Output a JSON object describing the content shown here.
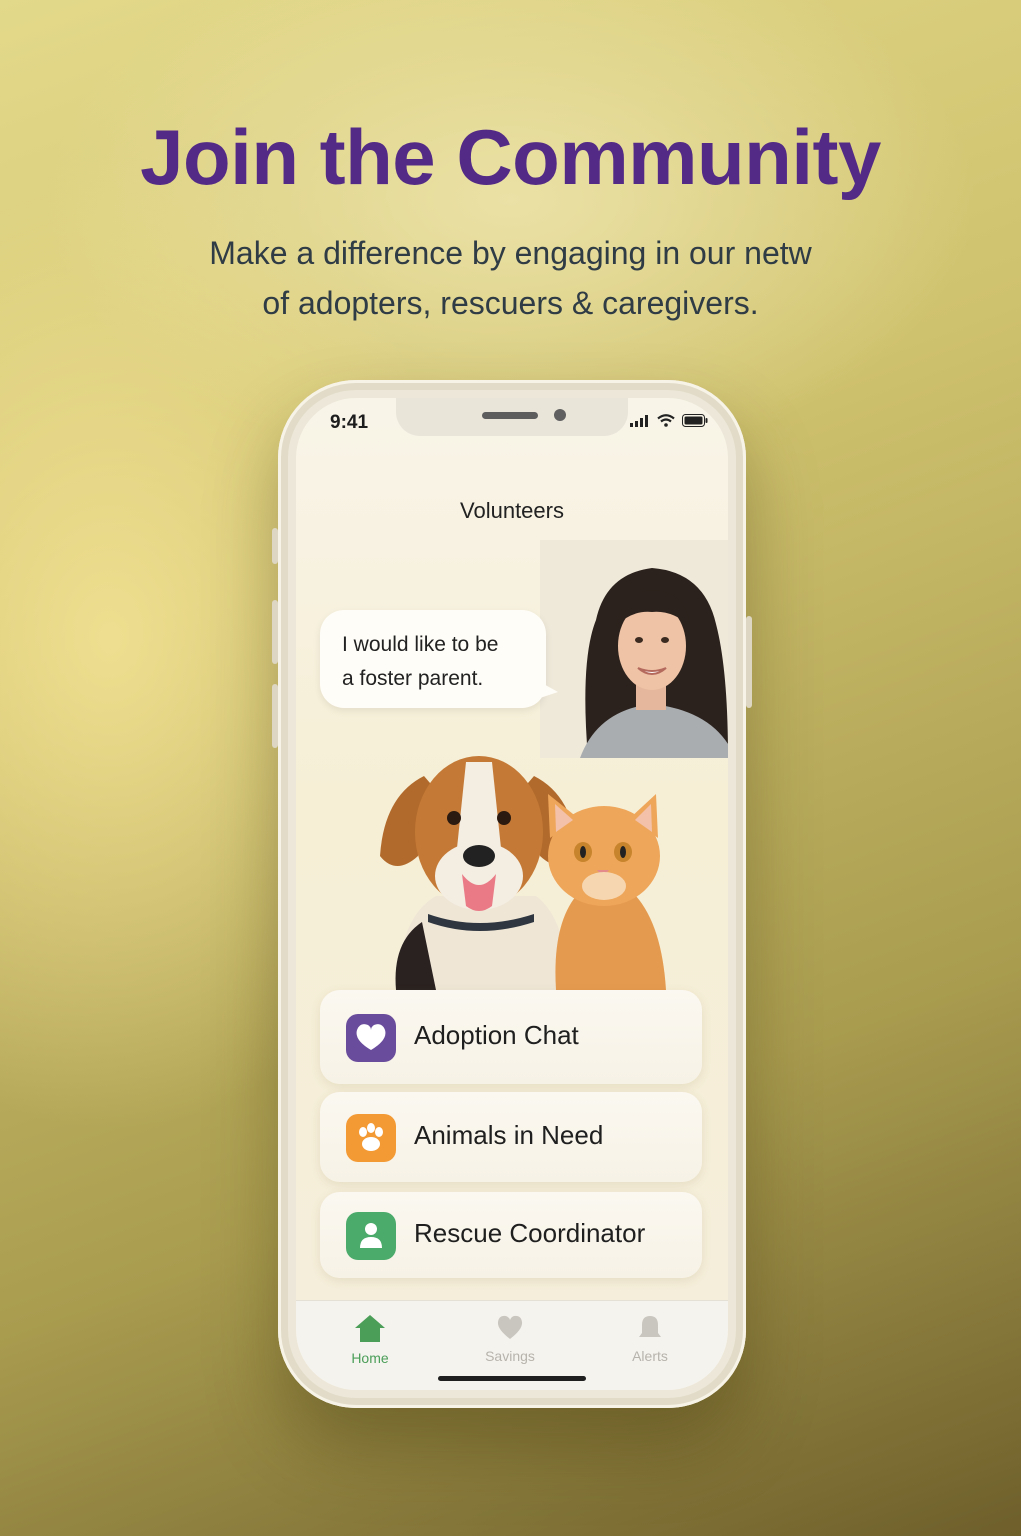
{
  "hero": {
    "title": "Join the Community",
    "subtitle_line1": "Make a difference by engaging in our netw",
    "subtitle_line2": "of adopters, rescuers & caregivers."
  },
  "status_bar": {
    "time": "9:41"
  },
  "screen": {
    "title": "Volunteers",
    "bubble_line1": "I would like to be",
    "bubble_line2": "a foster parent."
  },
  "cards": [
    {
      "label": "Adoption Chat",
      "icon": "heart-chat-icon",
      "color": "#6a4c9c"
    },
    {
      "label": "Animals in Need",
      "icon": "paw-icon",
      "color": "#f39a35"
    },
    {
      "label": "Rescue Coordinator",
      "icon": "person-icon",
      "color": "#4bab6a"
    }
  ],
  "tabs": [
    {
      "label": "Home",
      "icon": "home-icon",
      "active": true,
      "color": "#4a9e58"
    },
    {
      "label": "Savings",
      "icon": "heart-icon",
      "active": false,
      "color": "#b6b3ac"
    },
    {
      "label": "Alerts",
      "icon": "bell-icon",
      "active": false,
      "color": "#b6b3ac"
    }
  ]
}
